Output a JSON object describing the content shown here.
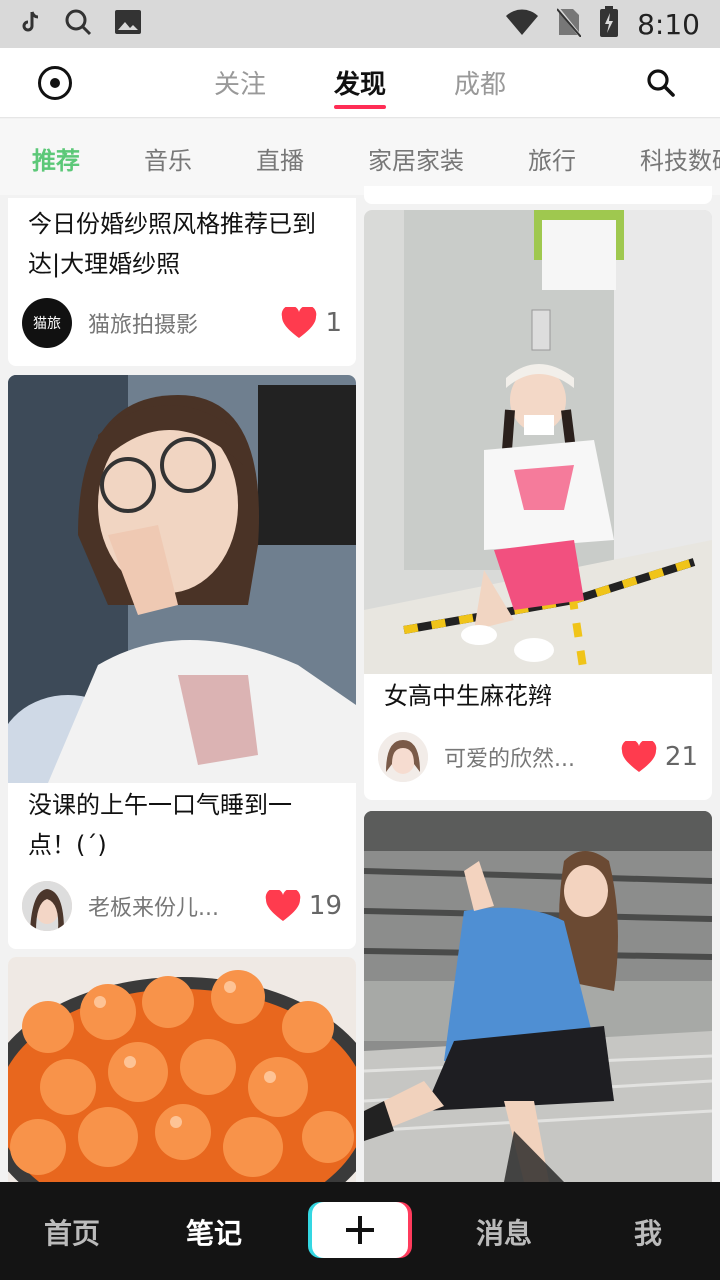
{
  "status_bar": {
    "time": "8:10",
    "icons": [
      "tiktok-icon",
      "search-icon",
      "image-icon",
      "wifi-icon",
      "no-sim-icon",
      "battery-icon"
    ]
  },
  "top_tabs": [
    {
      "label": "关注",
      "active": false
    },
    {
      "label": "发现",
      "active": true
    },
    {
      "label": "成都",
      "active": false
    }
  ],
  "categories": [
    {
      "label": "推荐",
      "active": true
    },
    {
      "label": "音乐",
      "active": false
    },
    {
      "label": "直播",
      "active": false
    },
    {
      "label": "家居家装",
      "active": false
    },
    {
      "label": "旅行",
      "active": false
    },
    {
      "label": "科技数码",
      "active": false
    }
  ],
  "feed": {
    "left": [
      {
        "title": "今日份婚纱照风格推荐已到达|大理婚纱照",
        "author": "猫旅拍摄影",
        "avatar_text": "猫旅",
        "likes": "1"
      },
      {
        "title": "没课的上午一口气睡到一点！(ˊ)",
        "author": "老板来份儿...",
        "likes": "19"
      },
      {
        "title": "",
        "author": "",
        "likes": ""
      }
    ],
    "right": [
      {
        "title": "女高中生麻花辫",
        "author": "可爱的欣然...",
        "likes": "21"
      },
      {
        "title": "",
        "author": "",
        "likes": ""
      }
    ]
  },
  "bottom_nav": [
    {
      "label": "首页",
      "active": false
    },
    {
      "label": "笔记",
      "active": true
    },
    {
      "label": "消息",
      "active": false
    },
    {
      "label": "我",
      "active": false
    }
  ],
  "colors": {
    "accent": "#ff2d55",
    "category_active": "#5cc878",
    "heart": "#ff3b4e",
    "nav_bg": "#141414"
  }
}
